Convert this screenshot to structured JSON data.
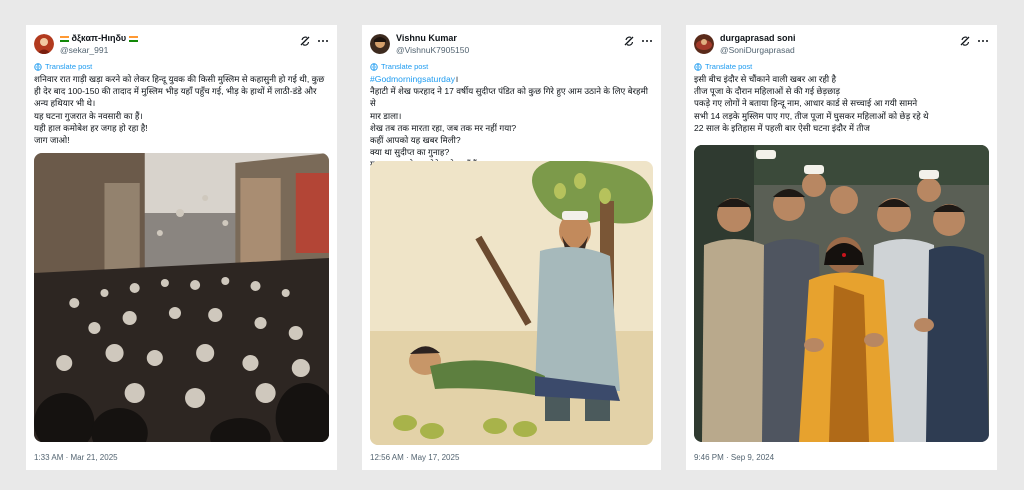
{
  "tweets": [
    {
      "display_name": "ðξкαπ-Ηιηδυ",
      "handle": "@sekar_991",
      "translate_label": "Translate post",
      "lines": [
        "शनिवार रात गाड़ी खड़ा करने को लेकर हिन्दू युवक की किसी मुस्लिम से कहासुनी हो गई थी, कुछ",
        "ही देर बाद 100-150 की तादाद में मुस्लिम भीड़ यहाँ पहुँच गई, भीड़ के हाथों में लाठी-डंडे और",
        "अन्य हथियार भी थे।",
        "यह घटना गुजरात के नवसारी का हैं।",
        "यही हाल कमोबेश हर जगह हो रहा है!",
        "जाग जाओ!"
      ],
      "timestamp": "1:33 AM · Mar 21, 2025"
    },
    {
      "display_name": "Vishnu Kumar",
      "handle": "@VishnuK7905150",
      "translate_label": "Translate post",
      "hashtag": "#Godmorningsaturday",
      "hashtag_suffix": "।",
      "lines": [
        "नैहाटी में शेख फरहाद ने 17 वर्षीय सुदीप्त पंडित को कुछ गिरे हुए आम उठाने के लिए बेरहमी से",
        "मार डाला।",
        "शेख तब तक मारता रहा, जब तक मर नहीं गया?",
        "कहीं आपको यह खबर मिली?",
        "क्या था सुदीप्त का गुनाह?",
        "मानवता का लेक्चर देने वाले कहाँ हैं?"
      ],
      "timestamp": "12:56 AM · May 17, 2025"
    },
    {
      "display_name": "durgaprasad soni",
      "handle": "@SoniDurgaprasad",
      "translate_label": "Translate post",
      "lines": [
        "इसी बीच इंदौर से चौंकाने वाली खबर आ रही है",
        "तीज पूजा के दौरान महिलाओं से की गई छेड़छाड़",
        "पकड़े गए लोगों ने बताया हिन्दू नाम, आधार कार्ड से सच्चाई आ गयी सामने",
        "सभी 14 लड़के मुस्लिम पाए गए, तीज पूजा में घुसकर महिलाओं को छेड़ रहे थे",
        "22 साल के इतिहास में पहली बार ऐसी घटना इंदौर में तीज"
      ],
      "timestamp": "9:46 PM · Sep 9, 2024"
    }
  ],
  "icons": {
    "grok": "grok-icon",
    "more": "more-icon",
    "translate": "globe-icon",
    "flag": "india-flag-icon"
  },
  "colors": {
    "link": "#1d9bf0",
    "secondary_text": "#536471",
    "primary_text": "#0f1419",
    "background": "#e9e9e9"
  }
}
